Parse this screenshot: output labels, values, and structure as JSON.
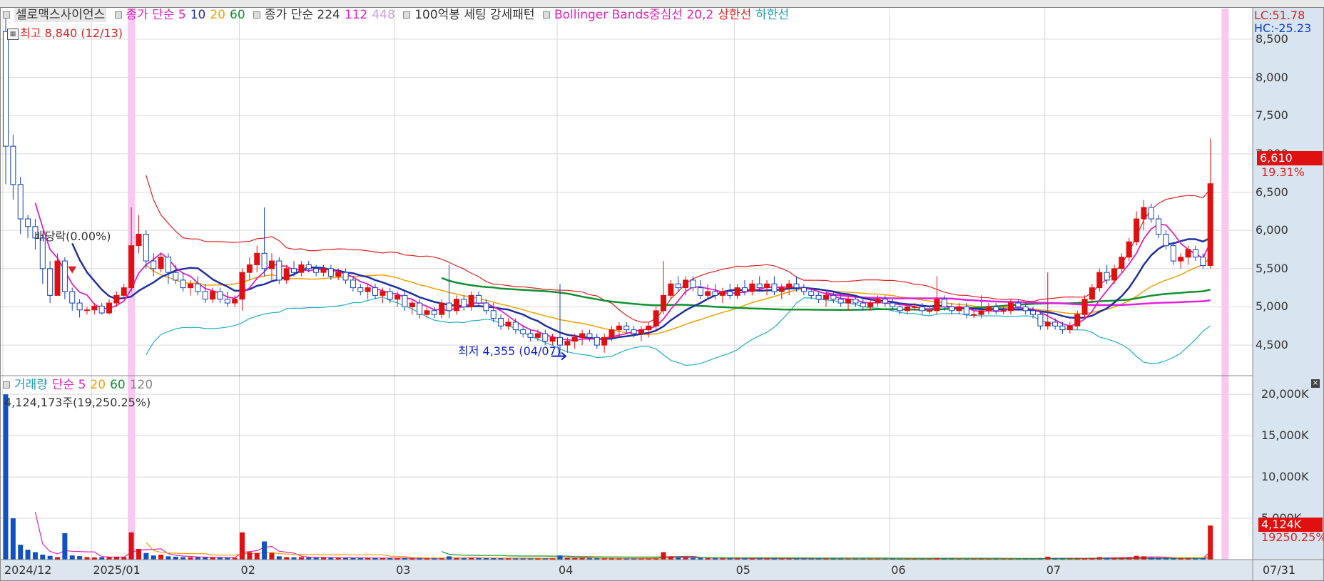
{
  "chart_data": {
    "type": "candlestick",
    "title": "셀로맥스사이언스",
    "price_legend": [
      {
        "text": "종가 단순 5",
        "color": "#e020c0"
      },
      {
        "text": "10",
        "color": "#2030a0"
      },
      {
        "text": "20",
        "color": "#f0a000"
      },
      {
        "text": "60",
        "color": "#109030"
      },
      {
        "text": "종가 단순 224",
        "color": "#333333"
      },
      {
        "text": "112",
        "color": "#e020e0"
      },
      {
        "text": "448",
        "color": "#c8a0e0"
      },
      {
        "text": "100억봉 세팅 강세패턴",
        "color": "#333333"
      },
      {
        "text": "Bollinger Bands중심선 20,2",
        "color": "#e020c0"
      },
      {
        "text": "상한선",
        "color": "#e02020"
      },
      {
        "text": "하한선",
        "color": "#20a0b0"
      }
    ],
    "volume_legend": [
      {
        "text": "거래량",
        "color": "#20a0b0"
      },
      {
        "text": "단순 5",
        "color": "#e020c0"
      },
      {
        "text": "20",
        "color": "#f0a000"
      },
      {
        "text": "60",
        "color": "#109030"
      },
      {
        "text": "120",
        "color": "#888888"
      }
    ],
    "annotations": {
      "high": "최고 8,840 (12/13)",
      "low": "최저 4,355 (04/07)",
      "dividend": "배당락(0.00%)",
      "lc": "LC:51.78",
      "hc": "HC:-25.23",
      "last_price": "6,610",
      "last_change": "19.31%",
      "last_volume": "4,124K",
      "last_volume_pct": "19250.25%",
      "volume_header": "4,124,173주(19,250.25%)"
    },
    "price_axis": {
      "ylim": [
        4100,
        8900
      ],
      "ticks": [
        4500,
        5000,
        5500,
        6000,
        6500,
        7000,
        7500,
        8000,
        8500
      ],
      "tick_labels": [
        "4,500",
        "5,000",
        "5,500",
        "6,000",
        "6,500",
        "7,000",
        "7,500",
        "8,000",
        "8,500"
      ]
    },
    "volume_axis": {
      "ylim": [
        0,
        22000
      ],
      "ticks": [
        5000,
        10000,
        15000,
        20000
      ],
      "tick_labels": [
        "5,000K",
        "10,000K",
        "15,000K",
        "20,000K"
      ]
    },
    "date_labels": [
      {
        "label": "2024/12",
        "index": 0
      },
      {
        "label": "2025/01",
        "index": 12
      },
      {
        "label": "02",
        "index": 32
      },
      {
        "label": "03",
        "index": 53
      },
      {
        "label": "04",
        "index": 75
      },
      {
        "label": "05",
        "index": 99
      },
      {
        "label": "06",
        "index": 120
      },
      {
        "label": "07",
        "index": 141
      },
      {
        "label": "07/31",
        "index": 165
      }
    ],
    "highlight_indices": [
      17,
      165
    ],
    "candles": [
      [
        8600,
        8840,
        6600,
        7100,
        20000
      ],
      [
        7100,
        7250,
        6400,
        6600,
        5000
      ],
      [
        6600,
        6700,
        5950,
        6150,
        1800
      ],
      [
        6150,
        6200,
        5900,
        6050,
        1200
      ],
      [
        6050,
        6150,
        5750,
        5900,
        900
      ],
      [
        5900,
        5950,
        5300,
        5500,
        600
      ],
      [
        5500,
        5600,
        5050,
        5150,
        450
      ],
      [
        5150,
        5700,
        5150,
        5600,
        300
      ],
      [
        5600,
        5650,
        5100,
        5200,
        3200
      ],
      [
        5200,
        5250,
        4950,
        5050,
        500
      ],
      [
        5050,
        5100,
        4860,
        4960,
        420
      ],
      [
        4960,
        5000,
        4900,
        4960,
        300
      ],
      [
        4960,
        5050,
        4900,
        5010,
        260
      ],
      [
        5010,
        5050,
        4900,
        4920,
        280
      ],
      [
        4920,
        5100,
        4900,
        5050,
        300
      ],
      [
        5050,
        5200,
        5000,
        5150,
        350
      ],
      [
        5150,
        5300,
        5100,
        5250,
        300
      ],
      [
        5250,
        6300,
        5200,
        5800,
        3300
      ],
      [
        5800,
        6200,
        5700,
        5950,
        1300
      ],
      [
        5950,
        6000,
        5500,
        5600,
        800
      ],
      [
        5600,
        5700,
        5400,
        5500,
        500
      ],
      [
        5500,
        5700,
        5450,
        5650,
        600
      ],
      [
        5650,
        5700,
        5300,
        5450,
        400
      ],
      [
        5450,
        5550,
        5300,
        5350,
        350
      ],
      [
        5350,
        5450,
        5200,
        5250,
        300
      ],
      [
        5250,
        5350,
        5150,
        5300,
        280
      ],
      [
        5300,
        5400,
        5150,
        5200,
        300
      ],
      [
        5200,
        5300,
        5050,
        5100,
        260
      ],
      [
        5100,
        5250,
        5050,
        5200,
        250
      ],
      [
        5200,
        5250,
        5050,
        5100,
        230
      ],
      [
        5100,
        5200,
        5000,
        5050,
        220
      ],
      [
        5050,
        5150,
        5000,
        5100,
        220
      ],
      [
        5100,
        5500,
        4950,
        5450,
        3300
      ],
      [
        5450,
        5650,
        5350,
        5550,
        900
      ],
      [
        5550,
        5800,
        5450,
        5700,
        800
      ],
      [
        5700,
        6300,
        5400,
        5500,
        2200
      ],
      [
        5500,
        5700,
        5350,
        5600,
        800
      ],
      [
        5600,
        5650,
        5300,
        5350,
        400
      ],
      [
        5350,
        5550,
        5300,
        5500,
        300
      ],
      [
        5500,
        5600,
        5400,
        5450,
        280
      ],
      [
        5450,
        5600,
        5400,
        5550,
        300
      ],
      [
        5550,
        5600,
        5450,
        5500,
        250
      ],
      [
        5500,
        5550,
        5400,
        5450,
        240
      ],
      [
        5450,
        5550,
        5400,
        5500,
        230
      ],
      [
        5500,
        5550,
        5350,
        5400,
        220
      ],
      [
        5400,
        5500,
        5350,
        5450,
        220
      ],
      [
        5450,
        5500,
        5300,
        5350,
        210
      ],
      [
        5350,
        5400,
        5200,
        5250,
        200
      ],
      [
        5250,
        5300,
        5150,
        5200,
        200
      ],
      [
        5200,
        5300,
        5100,
        5250,
        190
      ],
      [
        5250,
        5300,
        5100,
        5150,
        190
      ],
      [
        5150,
        5250,
        5050,
        5200,
        180
      ],
      [
        5200,
        5250,
        5050,
        5100,
        180
      ],
      [
        5100,
        5200,
        5000,
        5150,
        170
      ],
      [
        5150,
        5200,
        4950,
        5000,
        170
      ],
      [
        5000,
        5100,
        4900,
        5050,
        160
      ],
      [
        5050,
        5100,
        4850,
        4900,
        160
      ],
      [
        4900,
        5000,
        4850,
        4950,
        150
      ],
      [
        4950,
        5000,
        4850,
        4900,
        150
      ],
      [
        4900,
        5100,
        4850,
        5050,
        150
      ],
      [
        5050,
        5550,
        4850,
        4950,
        400
      ],
      [
        4950,
        5150,
        4900,
        5100,
        200
      ],
      [
        5100,
        5150,
        4950,
        5000,
        180
      ],
      [
        5000,
        5200,
        4950,
        5150,
        200
      ],
      [
        5150,
        5200,
        5000,
        5050,
        180
      ],
      [
        5050,
        5100,
        4900,
        4950,
        170
      ],
      [
        4950,
        5050,
        4800,
        4850,
        170
      ],
      [
        4850,
        4900,
        4700,
        4750,
        160
      ],
      [
        4750,
        4850,
        4700,
        4800,
        150
      ],
      [
        4800,
        4850,
        4650,
        4700,
        150
      ],
      [
        4700,
        4750,
        4600,
        4650,
        150
      ],
      [
        4650,
        4700,
        4550,
        4600,
        140
      ],
      [
        4600,
        4700,
        4550,
        4650,
        140
      ],
      [
        4650,
        4700,
        4500,
        4550,
        140
      ],
      [
        4550,
        4650,
        4500,
        4600,
        140
      ],
      [
        4600,
        5300,
        4355,
        4500,
        500
      ],
      [
        4500,
        4600,
        4400,
        4550,
        200
      ],
      [
        4550,
        4650,
        4450,
        4600,
        180
      ],
      [
        4600,
        4700,
        4500,
        4650,
        170
      ],
      [
        4650,
        4700,
        4550,
        4600,
        160
      ],
      [
        4600,
        4650,
        4450,
        4500,
        160
      ],
      [
        4500,
        4650,
        4400,
        4600,
        150
      ],
      [
        4600,
        4750,
        4550,
        4700,
        150
      ],
      [
        4700,
        4800,
        4600,
        4750,
        140
      ],
      [
        4750,
        4800,
        4650,
        4700,
        140
      ],
      [
        4700,
        4750,
        4600,
        4650,
        140
      ],
      [
        4650,
        4750,
        4550,
        4700,
        140
      ],
      [
        4700,
        4800,
        4600,
        4750,
        140
      ],
      [
        4750,
        5000,
        4700,
        4950,
        150
      ],
      [
        4950,
        5600,
        4900,
        5150,
        900
      ],
      [
        5150,
        5350,
        5100,
        5300,
        400
      ],
      [
        5300,
        5400,
        5200,
        5250,
        250
      ],
      [
        5250,
        5400,
        5150,
        5350,
        250
      ],
      [
        5350,
        5400,
        5200,
        5250,
        200
      ],
      [
        5250,
        5350,
        5100,
        5150,
        180
      ],
      [
        5150,
        5300,
        5100,
        5200,
        170
      ],
      [
        5200,
        5300,
        5100,
        5150,
        160
      ],
      [
        5150,
        5250,
        5050,
        5200,
        150
      ],
      [
        5200,
        5300,
        5100,
        5150,
        150
      ],
      [
        5150,
        5300,
        5100,
        5250,
        150
      ],
      [
        5250,
        5350,
        5150,
        5200,
        140
      ],
      [
        5200,
        5350,
        5150,
        5300,
        140
      ],
      [
        5300,
        5400,
        5200,
        5250,
        140
      ],
      [
        5250,
        5350,
        5150,
        5300,
        140
      ],
      [
        5300,
        5400,
        5150,
        5200,
        140
      ],
      [
        5200,
        5300,
        5100,
        5250,
        130
      ],
      [
        5250,
        5350,
        5150,
        5300,
        130
      ],
      [
        5300,
        5400,
        5200,
        5250,
        130
      ],
      [
        5250,
        5300,
        5150,
        5200,
        130
      ],
      [
        5200,
        5250,
        5100,
        5150,
        120
      ],
      [
        5150,
        5200,
        5050,
        5100,
        120
      ],
      [
        5100,
        5200,
        5000,
        5150,
        120
      ],
      [
        5150,
        5200,
        5050,
        5100,
        120
      ],
      [
        5100,
        5150,
        5000,
        5050,
        120
      ],
      [
        5050,
        5150,
        4950,
        5100,
        110
      ],
      [
        5100,
        5150,
        5000,
        5050,
        110
      ],
      [
        5050,
        5100,
        4950,
        5000,
        110
      ],
      [
        5000,
        5100,
        4950,
        5050,
        110
      ],
      [
        5050,
        5150,
        5000,
        5100,
        110
      ],
      [
        5100,
        5150,
        5000,
        5050,
        110
      ],
      [
        5050,
        5100,
        4950,
        5000,
        110
      ],
      [
        5000,
        5050,
        4900,
        4950,
        100
      ],
      [
        4950,
        5050,
        4900,
        5000,
        100
      ],
      [
        5000,
        5050,
        4950,
        5000,
        100
      ],
      [
        5000,
        5050,
        4900,
        4950,
        100
      ],
      [
        4950,
        5000,
        4900,
        4950,
        100
      ],
      [
        4950,
        5400,
        4900,
        5100,
        180
      ],
      [
        5100,
        5150,
        4950,
        5000,
        120
      ],
      [
        5000,
        5050,
        4900,
        4950,
        110
      ],
      [
        4950,
        5050,
        4900,
        5000,
        100
      ],
      [
        5000,
        5050,
        4850,
        4900,
        100
      ],
      [
        4900,
        4950,
        4850,
        4900,
        100
      ],
      [
        4900,
        5150,
        4850,
        4950,
        110
      ],
      [
        4950,
        5050,
        4900,
        5000,
        100
      ],
      [
        5000,
        5050,
        4900,
        4950,
        100
      ],
      [
        4950,
        5000,
        4900,
        4950,
        100
      ],
      [
        4950,
        5100,
        4900,
        5050,
        100
      ],
      [
        5050,
        5100,
        4950,
        5000,
        100
      ],
      [
        5000,
        5050,
        4900,
        4950,
        100
      ],
      [
        4950,
        5000,
        4850,
        4900,
        100
      ],
      [
        4900,
        4950,
        4700,
        4750,
        120
      ],
      [
        4750,
        5450,
        4700,
        4800,
        350
      ],
      [
        4800,
        4850,
        4700,
        4750,
        130
      ],
      [
        4750,
        4800,
        4650,
        4700,
        120
      ],
      [
        4700,
        4800,
        4650,
        4750,
        120
      ],
      [
        4750,
        4950,
        4700,
        4900,
        140
      ],
      [
        4900,
        5150,
        4850,
        5100,
        180
      ],
      [
        5100,
        5300,
        5050,
        5250,
        200
      ],
      [
        5250,
        5500,
        5200,
        5450,
        300
      ],
      [
        5450,
        5550,
        5300,
        5350,
        200
      ],
      [
        5350,
        5550,
        5300,
        5500,
        220
      ],
      [
        5500,
        5700,
        5450,
        5650,
        250
      ],
      [
        5650,
        5900,
        5600,
        5850,
        300
      ],
      [
        5850,
        6250,
        5800,
        6150,
        450
      ],
      [
        6150,
        6400,
        6000,
        6300,
        400
      ],
      [
        6300,
        6350,
        6100,
        6150,
        250
      ],
      [
        6150,
        6200,
        5900,
        5950,
        220
      ],
      [
        5950,
        6000,
        5750,
        5800,
        200
      ],
      [
        5800,
        5850,
        5550,
        5600,
        180
      ],
      [
        5600,
        5700,
        5500,
        5650,
        160
      ],
      [
        5650,
        5800,
        5550,
        5750,
        160
      ],
      [
        5750,
        5800,
        5600,
        5650,
        150
      ],
      [
        5650,
        5700,
        5500,
        5540,
        150
      ],
      [
        5540,
        7200,
        5500,
        6610,
        4124
      ]
    ]
  }
}
